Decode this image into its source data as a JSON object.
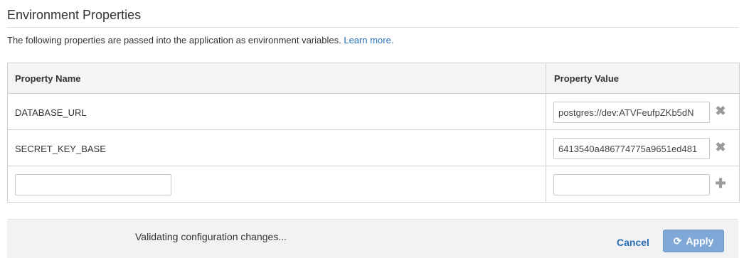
{
  "section": {
    "title": "Environment Properties",
    "description": "The following properties are passed into the application as environment variables.",
    "learn_more": "Learn more."
  },
  "table": {
    "headers": {
      "name": "Property Name",
      "value": "Property Value"
    },
    "rows": [
      {
        "name": "DATABASE_URL",
        "value": "postgres://dev:ATVFeufpZKb5dN",
        "action_icon": "remove-icon"
      },
      {
        "name": "SECRET_KEY_BASE",
        "value": "6413540a486774775a9651ed481",
        "action_icon": "remove-icon"
      }
    ],
    "new_row": {
      "name": "",
      "value": "",
      "action_icon": "add-icon"
    }
  },
  "footer": {
    "status": "Validating configuration changes...",
    "cancel_label": "Cancel",
    "apply_label": "Apply",
    "apply_icon": "refresh-icon"
  },
  "colors": {
    "link": "#2a6fb6",
    "apply_bg": "#7fa8d6"
  }
}
